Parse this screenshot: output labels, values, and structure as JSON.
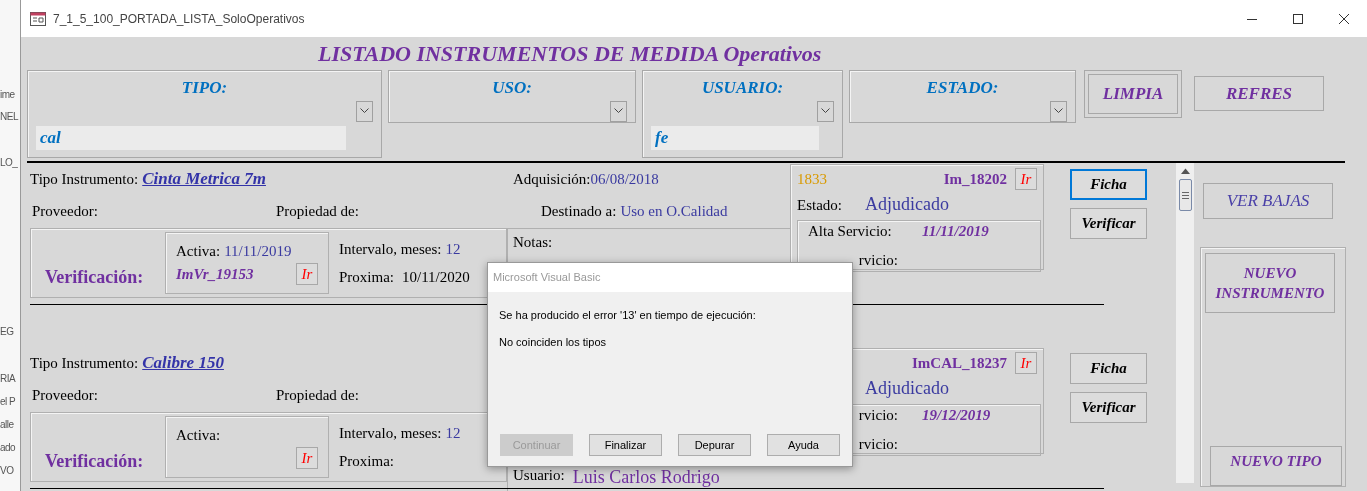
{
  "background_window": {
    "texts": [
      "ime",
      "NEL",
      "LO_",
      "EG",
      "RIA",
      "el P",
      "alle",
      "ado",
      "VO"
    ]
  },
  "window": {
    "title": "7_1_5_100_PORTADA_LISTA_SoloOperativos"
  },
  "form_title": "LISTADO INSTRUMENTOS DE MEDIDA Operativos",
  "filters": [
    {
      "label": "TIPO:",
      "value": "cal"
    },
    {
      "label": "USO:"
    },
    {
      "label": "USUARIO:",
      "value": "fe"
    },
    {
      "label": "ESTADO:"
    }
  ],
  "header_buttons": [
    {
      "label": "LIMPIA",
      "kind": "framed"
    },
    {
      "label": "REFRES",
      "kind": "plain"
    }
  ],
  "records": [
    {
      "tipo_label": "Tipo Instrumento:",
      "tipo": "Cinta Metrica 7m",
      "adquisicion_label": "Adquisición:",
      "adquisicion": "06/08/2018",
      "proveedor_label": "Proveedor:",
      "propiedad_label": "Propiedad de:",
      "destinado_label": "Destinado a:",
      "destinado": "Uso en O.Calidad",
      "verificacion_label": "Verificación:",
      "activa_label": "Activa:",
      "activa": "11/11/2019",
      "verif_code": "ImVr_19153",
      "verif_go": "Ir",
      "intervalo_label": "Intervalo, meses:",
      "intervalo": "12",
      "proxima_label": "Proxima:",
      "proxima": "10/11/2020",
      "notas_label": "Notas:",
      "numero": "1833",
      "code": "Im_18202",
      "code_go": "Ir",
      "estado_label": "Estado:",
      "estado": "Adjudicado",
      "alta_label": "Alta Servicio:",
      "alta": "11/11/2019",
      "baja_label": "rvicio:",
      "baja_label_cut": true,
      "ficha": {
        "label": "Ficha",
        "focused": true
      },
      "verificar": "Verificar"
    },
    {
      "tipo_label": "Tipo Instrumento:",
      "tipo": "Calibre 150",
      "proveedor_label": "Proveedor:",
      "propiedad_label": "Propiedad de:",
      "verificacion_label": "Verificación:",
      "activa_label": "Activa:",
      "verif_go": "Ir",
      "intervalo_label": "Intervalo, meses:",
      "intervalo": "12",
      "proxima_label": "Proxima:",
      "usuario_label": "Usuario:",
      "usuario": "Luis Carlos Rodrigo",
      "code": "ImCAL_18237",
      "code_go": "Ir",
      "estado": "Adjudicado",
      "alta_label": "rvicio:",
      "alta_label_cut": true,
      "alta": "19/12/2019",
      "baja_label": "rvicio:",
      "baja_label_cut": true,
      "ficha": {
        "label": "Ficha",
        "focused": false
      },
      "verificar": "Verificar"
    }
  ],
  "side_panel": {
    "ver_bajas": "VER BAJAS",
    "nuevo_instrumento": "NUEVO INSTRUMENTO",
    "nuevo_tipo": "NUEVO TIPO"
  },
  "dialog": {
    "title": "Microsoft Visual Basic",
    "message": "Se ha producido el error '13' en tiempo de ejecución:",
    "detail": "No coinciden los tipos",
    "buttons": [
      {
        "label": "Continuar",
        "disabled": true
      },
      {
        "label": "Finalizar",
        "disabled": false
      },
      {
        "label": "Depurar",
        "disabled": false
      },
      {
        "label": "Ayuda",
        "disabled": false
      }
    ]
  }
}
